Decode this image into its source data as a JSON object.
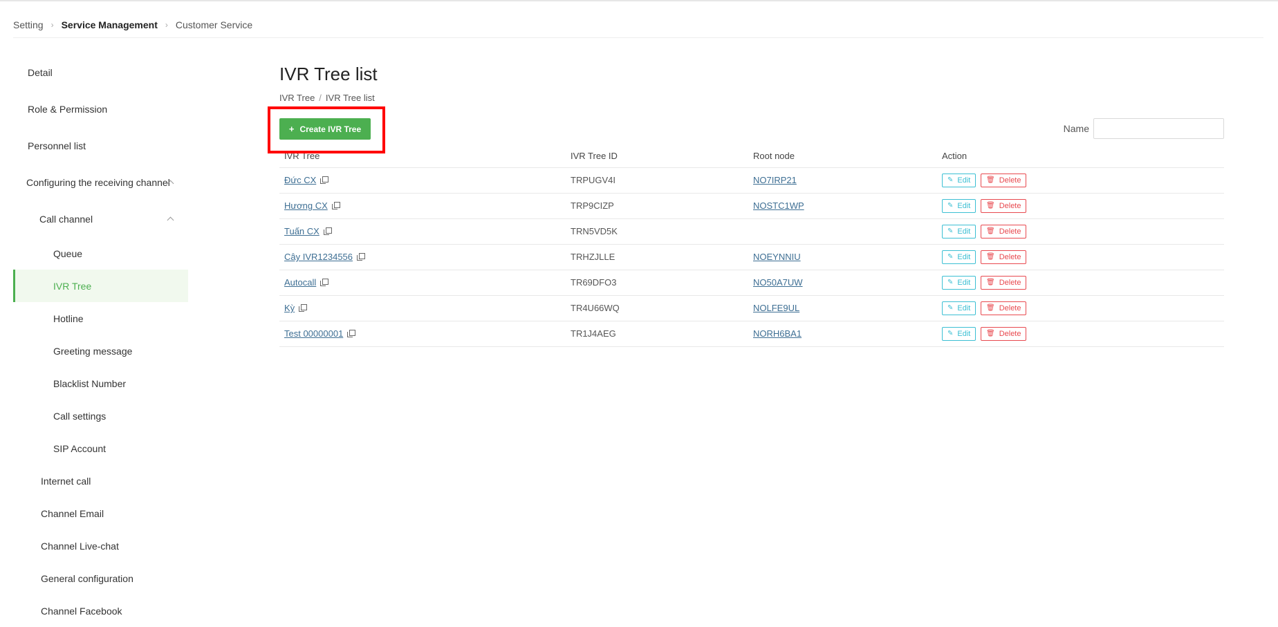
{
  "breadcrumb": {
    "items": [
      "Setting",
      "Service Management",
      "Customer Service"
    ]
  },
  "sidebar": {
    "items": [
      {
        "label": "Detail"
      },
      {
        "label": "Role & Permission"
      },
      {
        "label": "Personnel list"
      },
      {
        "label": "Configuring the receiving channel"
      },
      {
        "label": "Call channel"
      },
      {
        "label": "Queue"
      },
      {
        "label": "IVR Tree"
      },
      {
        "label": "Hotline"
      },
      {
        "label": "Greeting message"
      },
      {
        "label": "Blacklist Number"
      },
      {
        "label": "Call settings"
      },
      {
        "label": "SIP Account"
      },
      {
        "label": "Internet call"
      },
      {
        "label": "Channel Email"
      },
      {
        "label": "Channel Live-chat"
      },
      {
        "label": "General configuration"
      },
      {
        "label": "Channel Facebook"
      }
    ]
  },
  "main": {
    "title": "IVR Tree list",
    "crumbs": [
      "IVR Tree",
      "IVR Tree list"
    ],
    "create_label": "Create IVR Tree",
    "filter_label": "Name",
    "filter_value": ""
  },
  "table": {
    "columns": [
      "IVR Tree",
      "IVR Tree ID",
      "Root node",
      "Action"
    ],
    "edit_label": "Edit",
    "delete_label": "Delete",
    "rows": [
      {
        "name": "Đức CX",
        "id": "TRPUGV4I",
        "root": "NO7IRP21"
      },
      {
        "name": "Hương CX",
        "id": "TRP9CIZP",
        "root": "NOSTC1WP"
      },
      {
        "name": "Tuấn CX",
        "id": "TRN5VD5K",
        "root": ""
      },
      {
        "name": "Cây IVR1234556",
        "id": "TRHZJLLE",
        "root": "NOEYNNIU"
      },
      {
        "name": "Autocall",
        "id": "TR69DFO3",
        "root": "NO50A7UW"
      },
      {
        "name": "Kỳ",
        "id": "TR4U66WQ",
        "root": "NOLFE9UL"
      },
      {
        "name": "Test 00000001",
        "id": "TR1J4AEG",
        "root": "NORH6BA1"
      }
    ]
  },
  "colors": {
    "accent": "#4caf50",
    "edit": "#3bbfd3",
    "delete": "#e8484e",
    "highlight": "#ff0000",
    "link": "#3d6e93"
  }
}
